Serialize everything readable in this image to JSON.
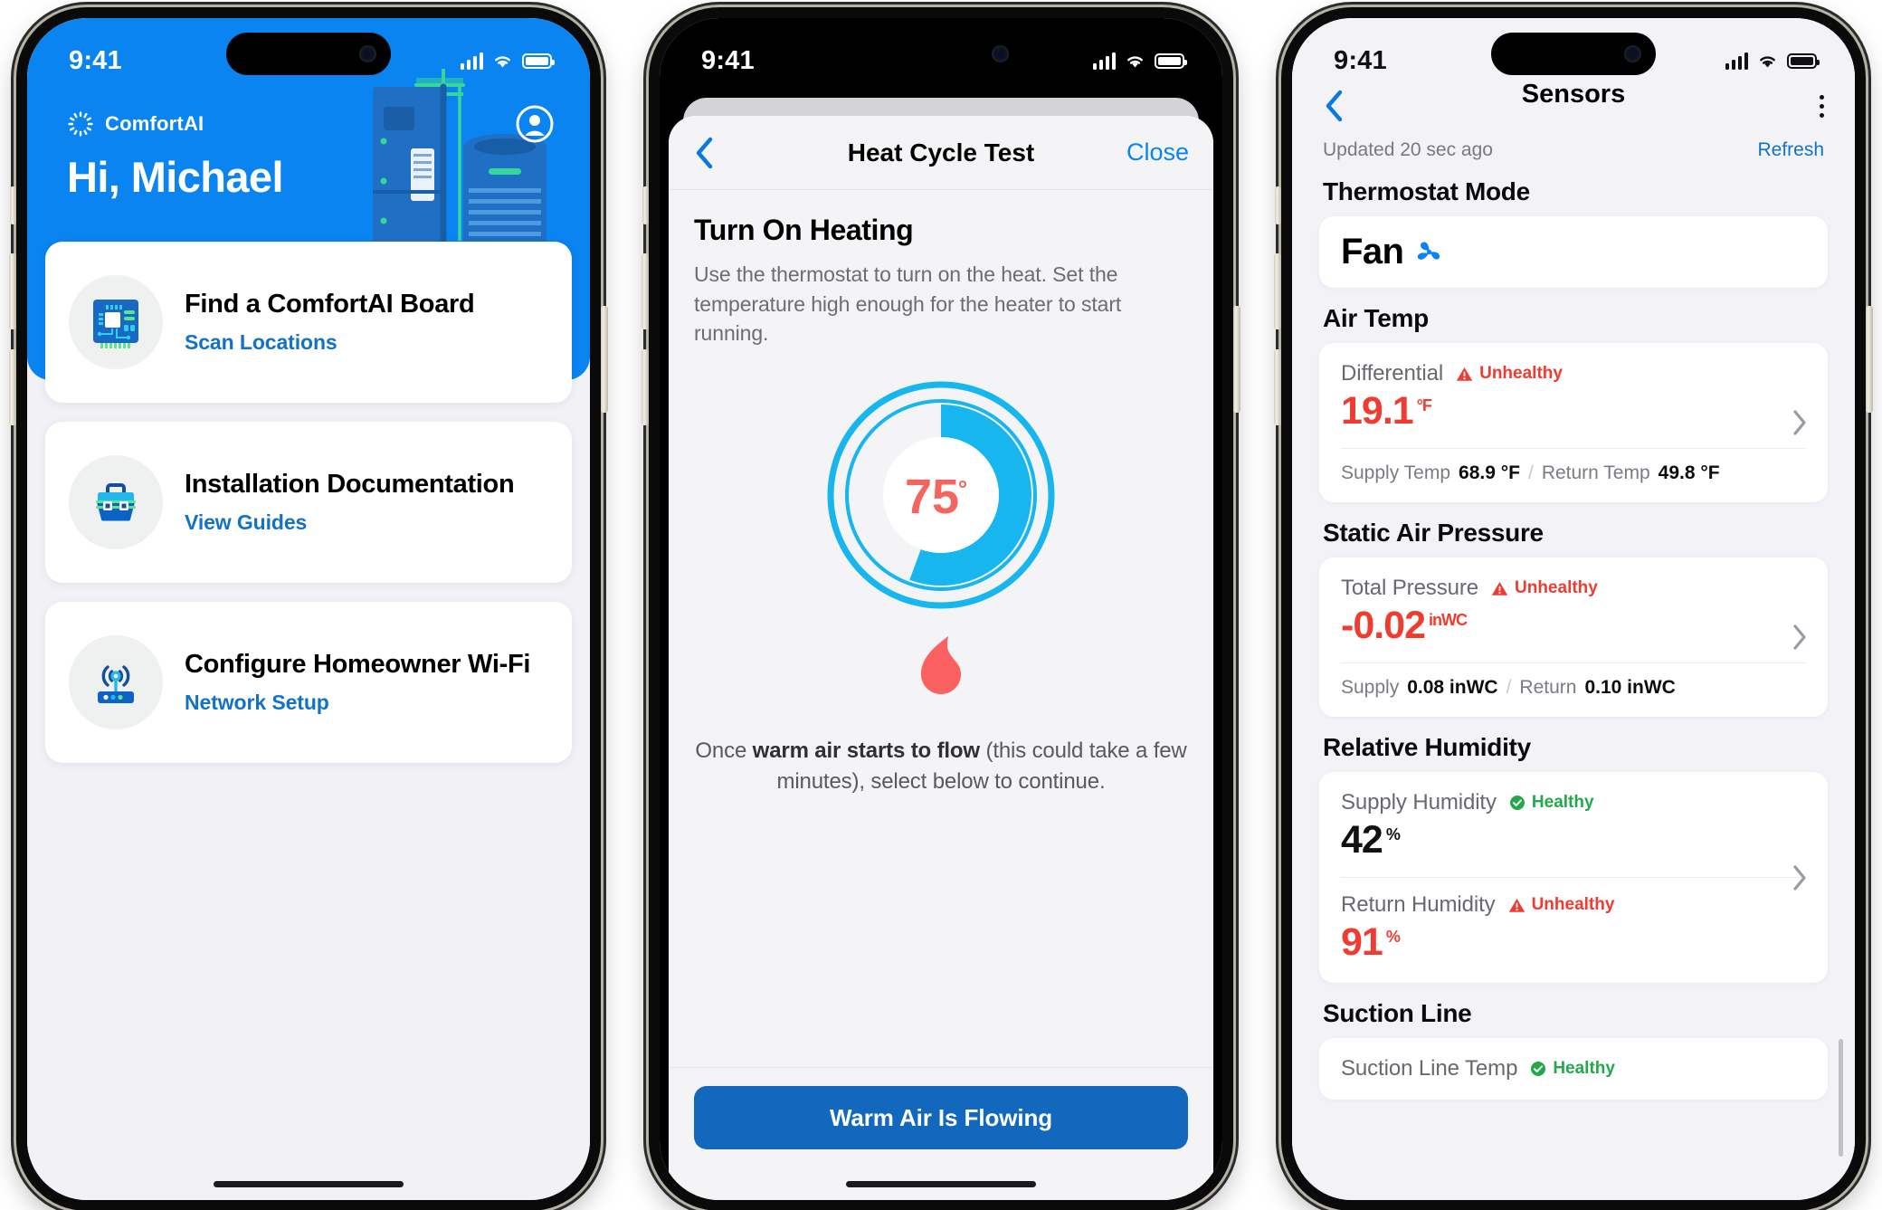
{
  "phone1": {
    "status": {
      "time": "9:41",
      "signal_icon": "cellular-signal-icon",
      "wifi_icon": "wifi-icon",
      "battery_icon": "battery-icon"
    },
    "brand": "ComfortAI",
    "greeting": "Hi, Michael",
    "account_icon": "account-circle-icon",
    "hero_art": "hvac-furnace-condenser-illustration",
    "cards": [
      {
        "icon": "circuit-board-icon",
        "title": "Find a ComfortAI Board",
        "link": "Scan Locations"
      },
      {
        "icon": "toolbox-icon",
        "title": "Installation Documentation",
        "link": "View Guides"
      },
      {
        "icon": "wifi-router-icon",
        "title": "Configure Homeowner Wi-Fi",
        "link": "Network Setup"
      }
    ]
  },
  "phone2": {
    "status": {
      "time": "9:41",
      "signal_icon": "cellular-signal-icon",
      "wifi_icon": "wifi-icon",
      "battery_icon": "battery-icon"
    },
    "nav": {
      "back_icon": "chevron-left-icon",
      "title": "Heat Cycle Test",
      "close": "Close"
    },
    "heading": "Turn On Heating",
    "subtitle": "Use the thermostat to turn on the heat. Set the temperature high enough for the heater to start running.",
    "thermostat": {
      "temperature": "75",
      "degree_symbol": "°",
      "icon": "thermostat-dial-icon"
    },
    "flame_icon": "flame-icon",
    "note_pre": "Once ",
    "note_bold": "warm air starts to flow",
    "note_post": " (this could take a few minutes), select below to continue.",
    "cta": "Warm Air Is Flowing"
  },
  "phone3": {
    "status": {
      "time": "9:41",
      "signal_icon": "cellular-signal-icon",
      "wifi_icon": "wifi-icon",
      "battery_icon": "battery-icon"
    },
    "nav": {
      "back_icon": "chevron-left-icon",
      "title": "Sensors",
      "menu_icon": "overflow-menu-icon"
    },
    "updated": "Updated 20 sec ago",
    "refresh": "Refresh",
    "sections": [
      {
        "heading": "Thermostat Mode",
        "mode_value": "Fan",
        "mode_icon": "fan-icon"
      },
      {
        "heading": "Air Temp",
        "metric_label": "Differential",
        "status_label": "Unhealthy",
        "status_kind": "bad",
        "value": "19.1",
        "unit": "°F",
        "sub": [
          {
            "k": "Supply Temp",
            "v": "68.9 °F"
          },
          {
            "k": "Return Temp",
            "v": "49.8 °F"
          }
        ],
        "chevron_icon": "chevron-right-icon"
      },
      {
        "heading": "Static Air Pressure",
        "metric_label": "Total Pressure",
        "status_label": "Unhealthy",
        "status_kind": "bad",
        "value": "-0.02",
        "unit": "inWC",
        "sub": [
          {
            "k": "Supply",
            "v": "0.08 inWC"
          },
          {
            "k": "Return",
            "v": "0.10 inWC"
          }
        ],
        "chevron_icon": "chevron-right-icon"
      },
      {
        "heading": "Relative Humidity",
        "rows": [
          {
            "metric_label": "Supply Humidity",
            "status_label": "Healthy",
            "status_kind": "ok",
            "value": "42",
            "unit": "%"
          },
          {
            "metric_label": "Return Humidity",
            "status_label": "Unhealthy",
            "status_kind": "bad",
            "value": "91",
            "unit": "%"
          }
        ],
        "chevron_icon": "chevron-right-icon"
      },
      {
        "heading": "Suction Line",
        "metric_label": "Suction Line Temp",
        "status_label": "Healthy",
        "status_kind": "ok"
      }
    ]
  },
  "colors": {
    "brand_blue": "#0a84f0",
    "link_blue": "#1272c8",
    "cta_blue": "#1168bd",
    "cyan": "#17b6ef",
    "red": "#f03c30",
    "green": "#23a94b",
    "page_bg": "#f3f3f7"
  }
}
